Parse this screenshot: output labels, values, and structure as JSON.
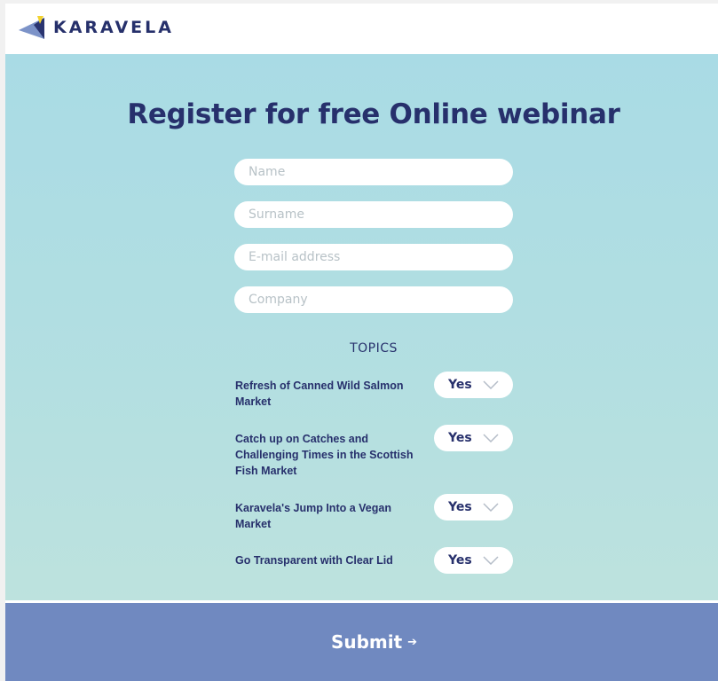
{
  "header": {
    "brand": "KARAVELA",
    "logo_colors": {
      "yellow": "#f2d22e",
      "blue": "#7c93c8",
      "navy": "#2a3470"
    }
  },
  "form": {
    "title": "Register for free Online webinar",
    "fields": {
      "name_placeholder": "Name",
      "surname_placeholder": "Surname",
      "email_placeholder": "E-mail address",
      "company_placeholder": "Company"
    },
    "topics_heading": "TOPICS",
    "topics": [
      {
        "label": "Refresh of Canned Wild Salmon Market",
        "value": "Yes"
      },
      {
        "label": "Catch up on Catches and Challenging Times in the Scottish Fish Market",
        "value": "Yes"
      },
      {
        "label": "Karavela's Jump Into a Vegan Market",
        "value": "Yes"
      },
      {
        "label": "Go Transparent with Clear Lid",
        "value": "Yes"
      }
    ],
    "submit_label": "Submit",
    "submit_icon": "arrow-right-icon"
  },
  "colors": {
    "background_top": "#a9dbe5",
    "background_bottom": "#bde2de",
    "accent": "#27306c",
    "submit_bar": "#7089c0"
  }
}
